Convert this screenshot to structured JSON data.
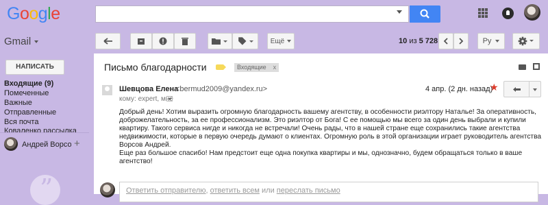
{
  "header": {
    "logo": "Google",
    "logo_colors": [
      "#4285f4",
      "#ea4335",
      "#fbbc05",
      "#4285f4",
      "#34a853",
      "#ea4335"
    ],
    "search_placeholder": "",
    "icons": [
      "search-icon",
      "apps-icon",
      "notifications-icon",
      "avatar"
    ]
  },
  "toolbar": {
    "gmail_label": "Gmail",
    "reply_icon": "↩",
    "more_label": "Ещё",
    "counter_range": "10",
    "counter_of": "из",
    "counter_total": "5 728",
    "lang": "Ру"
  },
  "sidebar": {
    "compose": "НАПИСАТЬ",
    "items": [
      {
        "label": "Входящие (9)"
      },
      {
        "label": "Помеченные"
      },
      {
        "label": "Важные"
      },
      {
        "label": "Отправленные"
      },
      {
        "label": "Вся почта"
      },
      {
        "label": "Коваленко рассылка"
      }
    ],
    "contact": "Андрей Ворсов",
    "add_symbol": "+"
  },
  "thread": {
    "subject": "Письмо благодарности",
    "label_chip": "Входящие",
    "label_chip_close": "x",
    "label_color": "#f6d95a"
  },
  "message": {
    "sender_name": "Шевцова Елена",
    "sender_email": "<bermud2009@yandex.ru>",
    "to_line": "кому: expert, мне",
    "date": "4 апр. (2 дн. назад)",
    "star": "★",
    "star_color": "#dd3b2b",
    "reply_icon": "↩",
    "body_lines": [
      "Добрый день! Хотим выразить огромную благодарность вашему агентству, в особенности риэлтору Наталье! За оперативность,",
      "доброжелательность, за ее профессионализм. Это риэлтор от Бога! С ее помощью мы всего за один день выбрали и купили",
      "квартиру. Такого сервиса нигде и никогда не встречали! Очень рады, что в нашей стране еще сохранились такие агентства",
      "недвижимости, которые в первую очередь думают о клиентах. Огромную роль в этой организации играет руководитель агентства",
      "Ворсов Андрей.",
      "Еще раз большое спасибо! Нам предстоит еще одна покупка квартиры и мы, однозначно, будем обращаться только в ваше",
      "агентство!"
    ]
  },
  "reply": {
    "reply_link": "Ответить отправителю",
    "sep1": ",",
    "reply_all_link": "ответить всем",
    "or": "или",
    "forward_link": "переслать письмо"
  }
}
